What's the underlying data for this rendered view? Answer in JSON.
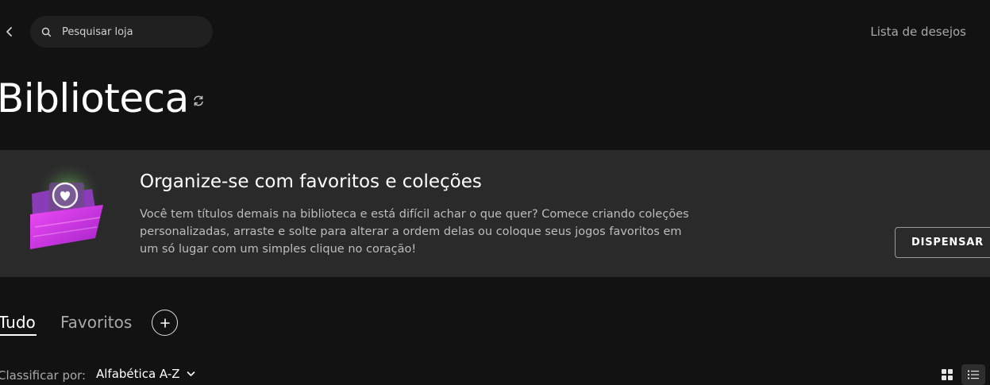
{
  "header": {
    "search_placeholder": "Pesquisar loja",
    "wishlist_label": "Lista de desejos"
  },
  "page": {
    "title": "Biblioteca"
  },
  "banner": {
    "title": "Organize-se com favoritos e coleções",
    "body": "Você tem títulos demais na biblioteca e está difícil achar o que quer? Comece criando coleções personalizadas, arraste e solte para alterar a ordem delas ou coloque seus jogos favoritos em um só lugar com um simples clique no coração!",
    "dismiss_label": "DISPENSAR"
  },
  "tabs": [
    {
      "label": "Tudo",
      "active": true
    },
    {
      "label": "Favoritos",
      "active": false
    }
  ],
  "sort": {
    "label": "Classificar por:",
    "value": "Alfabética A-Z"
  },
  "icons": {
    "back": "chevron-left-icon",
    "search": "search-icon",
    "refresh": "refresh-icon",
    "add": "plus-icon",
    "sort_chevron": "chevron-down-icon",
    "grid_view": "grid-view-icon",
    "list_view": "list-view-icon"
  },
  "colors": {
    "background": "#121212",
    "banner_bg": "#2a2a2a",
    "muted_text": "#a9a9a9",
    "folder_pink": "#d63ee6"
  }
}
